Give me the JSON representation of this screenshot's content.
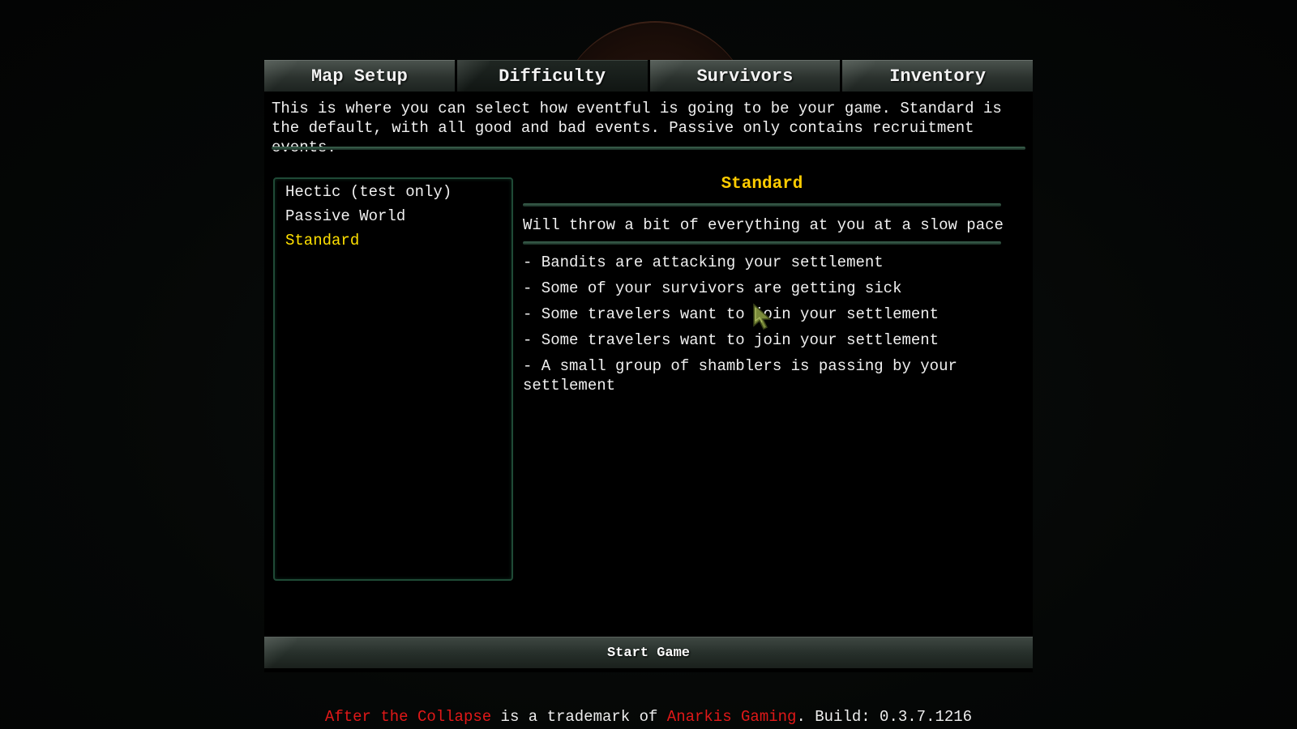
{
  "tabs": [
    {
      "label": "Map Setup",
      "active": false
    },
    {
      "label": "Difficulty",
      "active": true
    },
    {
      "label": "Survivors",
      "active": false
    },
    {
      "label": "Inventory",
      "active": false
    }
  ],
  "intro_text": "This is where you can select how eventful is going to be your game. Standard is the default, with all good and bad events. Passive only contains recruitment events.",
  "options": [
    {
      "label": "Hectic (test only)",
      "selected": false
    },
    {
      "label": "Passive World",
      "selected": false
    },
    {
      "label": "Standard",
      "selected": true
    }
  ],
  "detail": {
    "title": "Standard",
    "summary": "Will throw a bit of everything at you at a slow pace",
    "events": [
      "- Bandits are attacking your settlement",
      "- Some of your survivors are getting sick",
      "- Some travelers want to join your settlement",
      "- Some travelers want to join your settlement",
      "- A small group of shamblers is passing by your settlement"
    ]
  },
  "start_button_label": "Start Game",
  "footer": {
    "game_name": "After the Collapse",
    "middle": " is a trademark of ",
    "company": "Anarkis Gaming",
    "build": ". Build: 0.3.7.1216"
  },
  "colors": {
    "selected_item": "#ffe000",
    "detail_title": "#ffcc00",
    "footer_highlight": "#e01818",
    "divider": "#3d6652"
  },
  "cursor_icon": "arrow-cursor-icon"
}
